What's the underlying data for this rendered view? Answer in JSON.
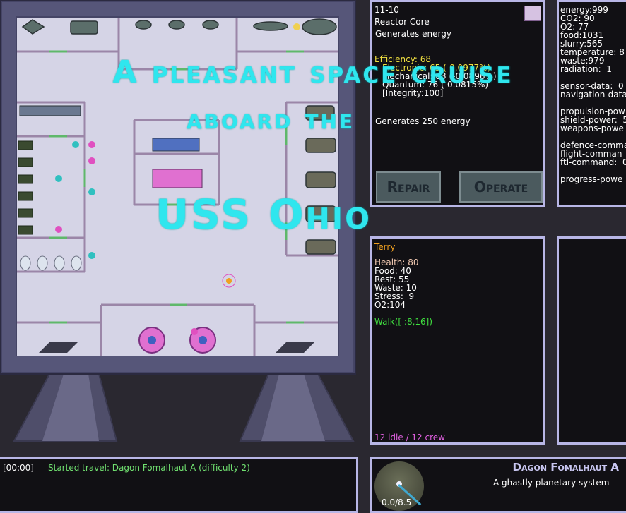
{
  "title": {
    "line1": "A pleasant space cruise",
    "line2": "aboard the",
    "line3": "USS Ohio"
  },
  "room_panel": {
    "room_id": "11-10",
    "room_name": "Reactor Core",
    "description": "Generates energy",
    "efficiency": "Efficiency: 68",
    "stats": [
      "Electronic: 65 (-0.0977%)",
      "Mechanical: 83 (-0.0896%)",
      "Quantum: 76 (-0.0815%)",
      "[Integrity:100]"
    ],
    "output": "Generates 250 energy",
    "repair_label": "Repair",
    "operate_label": "Operate"
  },
  "ship_stats": {
    "resources": [
      "energy:999",
      "CO2: 90",
      "O2: 77",
      "food:1031",
      "slurry:565",
      "temperature: 8",
      "waste:979",
      "radiation:  1"
    ],
    "data": [
      "sensor-data:  0",
      "navigation-data"
    ],
    "power": [
      "propulsion-pow",
      "shield-power:  5",
      "weapons-powe"
    ],
    "commands": [
      "defence-comma",
      "flight-comman",
      "ftl-command:  0"
    ],
    "progress": "progress-powe"
  },
  "crew_panel": {
    "name": "Terry",
    "stats": [
      "Health: 80",
      "Food: 40",
      "Rest: 55",
      "Waste: 10",
      "Stress:  9",
      "O2:104"
    ],
    "action": "Walk([ :8,16])",
    "crew_status": "12 idle / 12 crew"
  },
  "log": {
    "time": "[00:00]",
    "message": "Started travel: Dagon Fomalhaut A (difficulty 2)"
  },
  "destination": {
    "name": "Dagon Fomalhaut A",
    "description": "A ghastly planetary system",
    "progress": "0.0/8.5"
  },
  "colors": {
    "title": "#2fe6ee",
    "panel_border": "#b8b6e6",
    "efficiency": "#f0e040",
    "crew_name": "#f0a020",
    "crew_stats": "#f0c8b0",
    "action": "#40e040",
    "crew_status": "#e060e0",
    "log_message": "#70e070"
  }
}
